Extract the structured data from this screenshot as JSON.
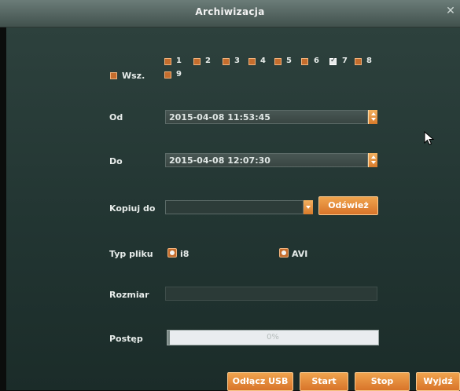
{
  "window": {
    "title": "Archiwizacja"
  },
  "channels": {
    "all_label": "Wsz.",
    "items": [
      {
        "label": "1",
        "checked": false
      },
      {
        "label": "2",
        "checked": false
      },
      {
        "label": "3",
        "checked": false
      },
      {
        "label": "4",
        "checked": false
      },
      {
        "label": "5",
        "checked": false
      },
      {
        "label": "6",
        "checked": false
      },
      {
        "label": "7",
        "checked": true
      },
      {
        "label": "8",
        "checked": false
      },
      {
        "label": "9",
        "checked": false
      }
    ]
  },
  "from": {
    "label": "Od",
    "value": "2015-04-08 11:53:45"
  },
  "to": {
    "label": "Do",
    "value": "2015-04-08 12:07:30"
  },
  "copy_to": {
    "label": "Kopiuj do",
    "value": "",
    "refresh_label": "Odśwież"
  },
  "file_type": {
    "label": "Typ pliku",
    "options": [
      "i8",
      "AVI"
    ]
  },
  "size": {
    "label": "Rozmiar",
    "value": ""
  },
  "progress": {
    "label": "Postęp",
    "percent_text": "0%",
    "fraction": 0.0
  },
  "buttons": {
    "eject_usb": "Odłącz USB",
    "start": "Start",
    "stop": "Stop",
    "exit": "Wyjdź"
  },
  "colors": {
    "accent": "#e08a36",
    "panel": "#2a3e3a",
    "titlebar": "#5a6b67"
  }
}
